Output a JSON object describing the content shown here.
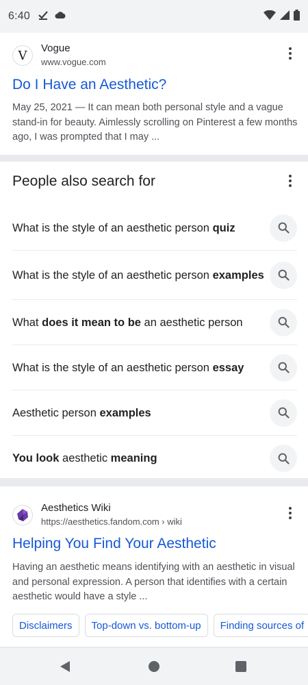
{
  "status_bar": {
    "time": "6:40",
    "left_icons": [
      "check-icon",
      "cloud-icon"
    ],
    "right_icons": [
      "wifi-icon",
      "cell-signal-icon",
      "battery-icon"
    ]
  },
  "result1": {
    "favicon_letter": "V",
    "site_name": "Vogue",
    "site_url": "www.vogue.com",
    "title": "Do I Have an Aesthetic?",
    "snippet": "May 25, 2021 — It can mean both personal style and a vague stand-in for beauty. Aimlessly scrolling on Pinterest a few months ago, I was prompted that I may ..."
  },
  "people_also_search": {
    "heading": "People also search for",
    "items": [
      [
        {
          "t": "What is the style of an aesthetic person ",
          "b": false
        },
        {
          "t": "quiz",
          "b": true
        }
      ],
      [
        {
          "t": "What is the style of an aesthetic person ",
          "b": false
        },
        {
          "t": "examples",
          "b": true
        }
      ],
      [
        {
          "t": "What ",
          "b": false
        },
        {
          "t": "does it mean to be",
          "b": true
        },
        {
          "t": " an aesthetic person",
          "b": false
        }
      ],
      [
        {
          "t": "What is the style of an aesthetic person ",
          "b": false
        },
        {
          "t": "essay",
          "b": true
        }
      ],
      [
        {
          "t": "Aesthetic person ",
          "b": false
        },
        {
          "t": "examples",
          "b": true
        }
      ],
      [
        {
          "t": "You look",
          "b": true
        },
        {
          "t": " aesthetic ",
          "b": false
        },
        {
          "t": "meaning",
          "b": true
        }
      ]
    ]
  },
  "result2": {
    "site_name": "Aesthetics Wiki",
    "site_url": "https://aesthetics.fandom.com › wiki",
    "title": "Helping You Find Your Aesthetic",
    "snippet": "Having an aesthetic means identifying with an aesthetic in visual and personal expression. A person that identifies with a certain aesthetic would have a style ...",
    "chips": [
      "Disclaimers",
      "Top-down vs. bottom-up",
      "Finding sources of"
    ]
  },
  "colors": {
    "link": "#1558d6",
    "text": "#202124",
    "snippet": "#4d5156",
    "background": "#e8eaed"
  },
  "nav_bar": {
    "buttons": [
      "back-icon",
      "home-icon",
      "recents-icon"
    ]
  }
}
